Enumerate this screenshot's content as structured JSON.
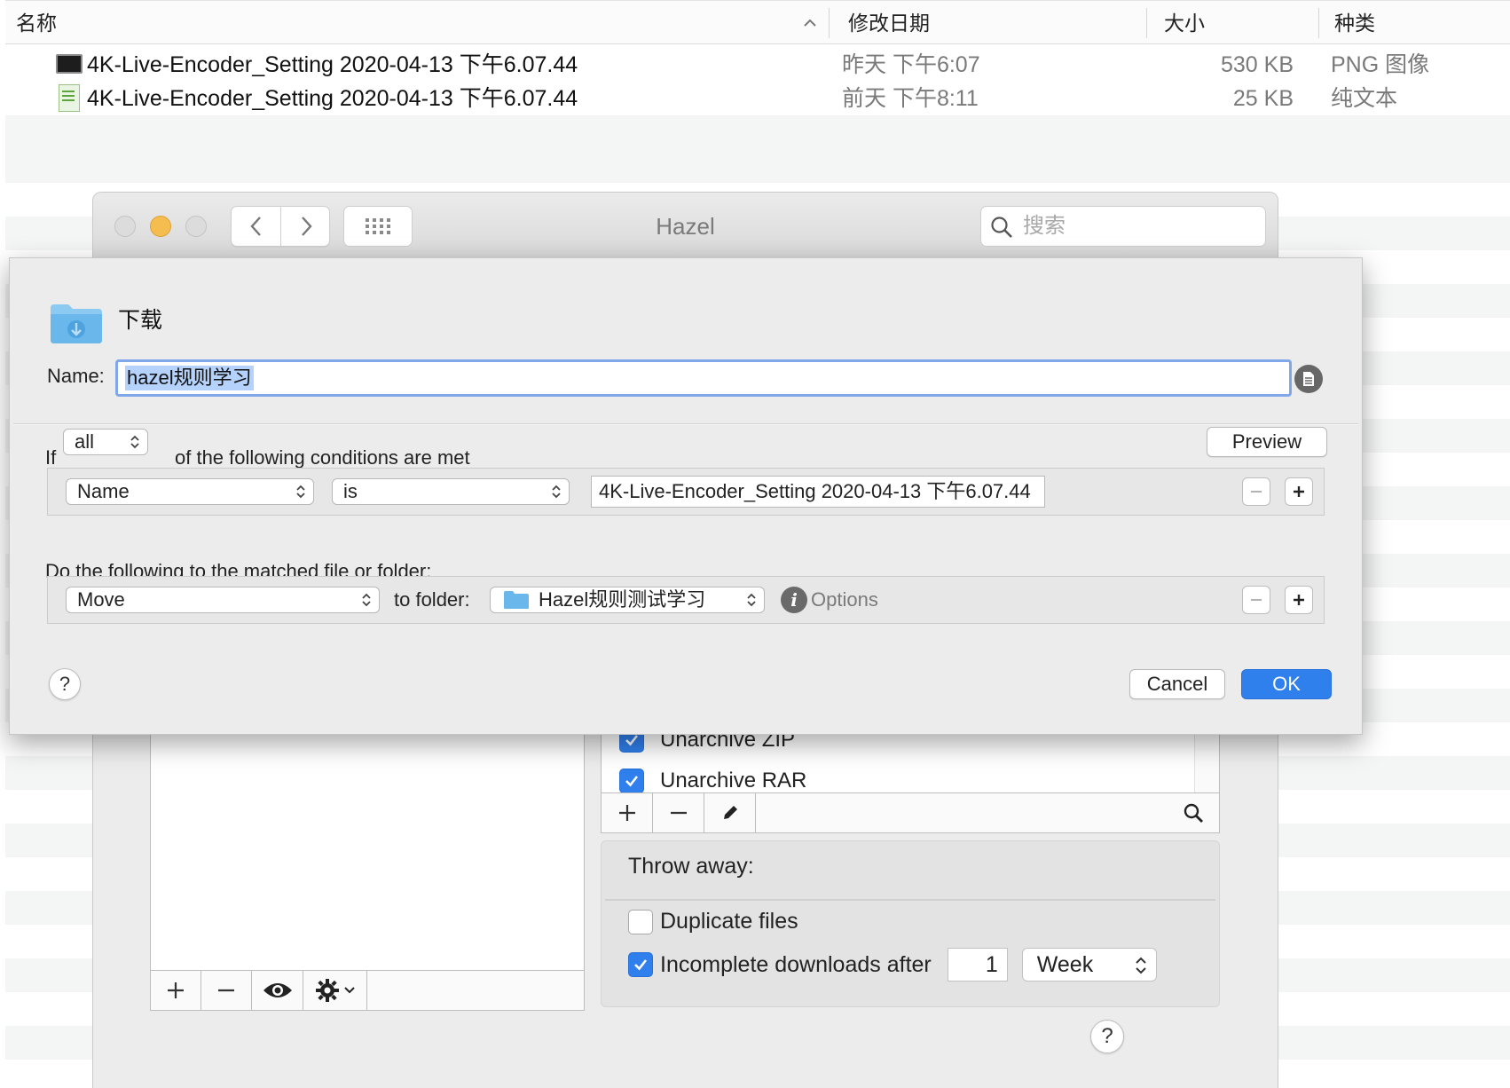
{
  "finder": {
    "columns": [
      "名称",
      "修改日期",
      "大小",
      "种类"
    ],
    "rows": [
      {
        "name": "4K-Live-Encoder_Setting 2020-04-13 下午6.07.44",
        "date": "昨天 下午6:07",
        "size": "530 KB",
        "kind": "PNG 图像",
        "icon": "png-file-icon"
      },
      {
        "name": "4K-Live-Encoder_Setting 2020-04-13 下午6.07.44",
        "date": "前天 下午8:11",
        "size": "25 KB",
        "kind": "纯文本",
        "icon": "text-file-icon"
      }
    ]
  },
  "hazel": {
    "title": "Hazel",
    "search_placeholder": "搜索",
    "rules": [
      "Unarchive ZIP",
      "Unarchive RAR"
    ],
    "throw_away": {
      "title": "Throw away:",
      "duplicate_label": "Duplicate files",
      "duplicate_checked": false,
      "incomplete_label": "Incomplete downloads after",
      "incomplete_checked": true,
      "incomplete_count": "1",
      "incomplete_unit": "Week"
    },
    "help": "?"
  },
  "sheet": {
    "folder_name": "下载",
    "name_label": "Name:",
    "name_value": "hazel规则学习",
    "if_label": "If",
    "match_mode": "all",
    "conditions_text": "of the following conditions are met",
    "preview_label": "Preview",
    "condition": {
      "attribute": "Name",
      "operator": "is",
      "value": "4K-Live-Encoder_Setting 2020-04-13 下午6.07.44"
    },
    "do_label": "Do the following to the matched file or folder:",
    "action": {
      "verb": "Move",
      "to_folder_label": "to folder:",
      "folder": "Hazel规则测试学习",
      "options_label": "Options"
    },
    "help": "?",
    "cancel_label": "Cancel",
    "ok_label": "OK"
  },
  "colors": {
    "accent": "#2f7fec",
    "selection": "#b4d2fc",
    "minimize": "#f5bd4f"
  }
}
